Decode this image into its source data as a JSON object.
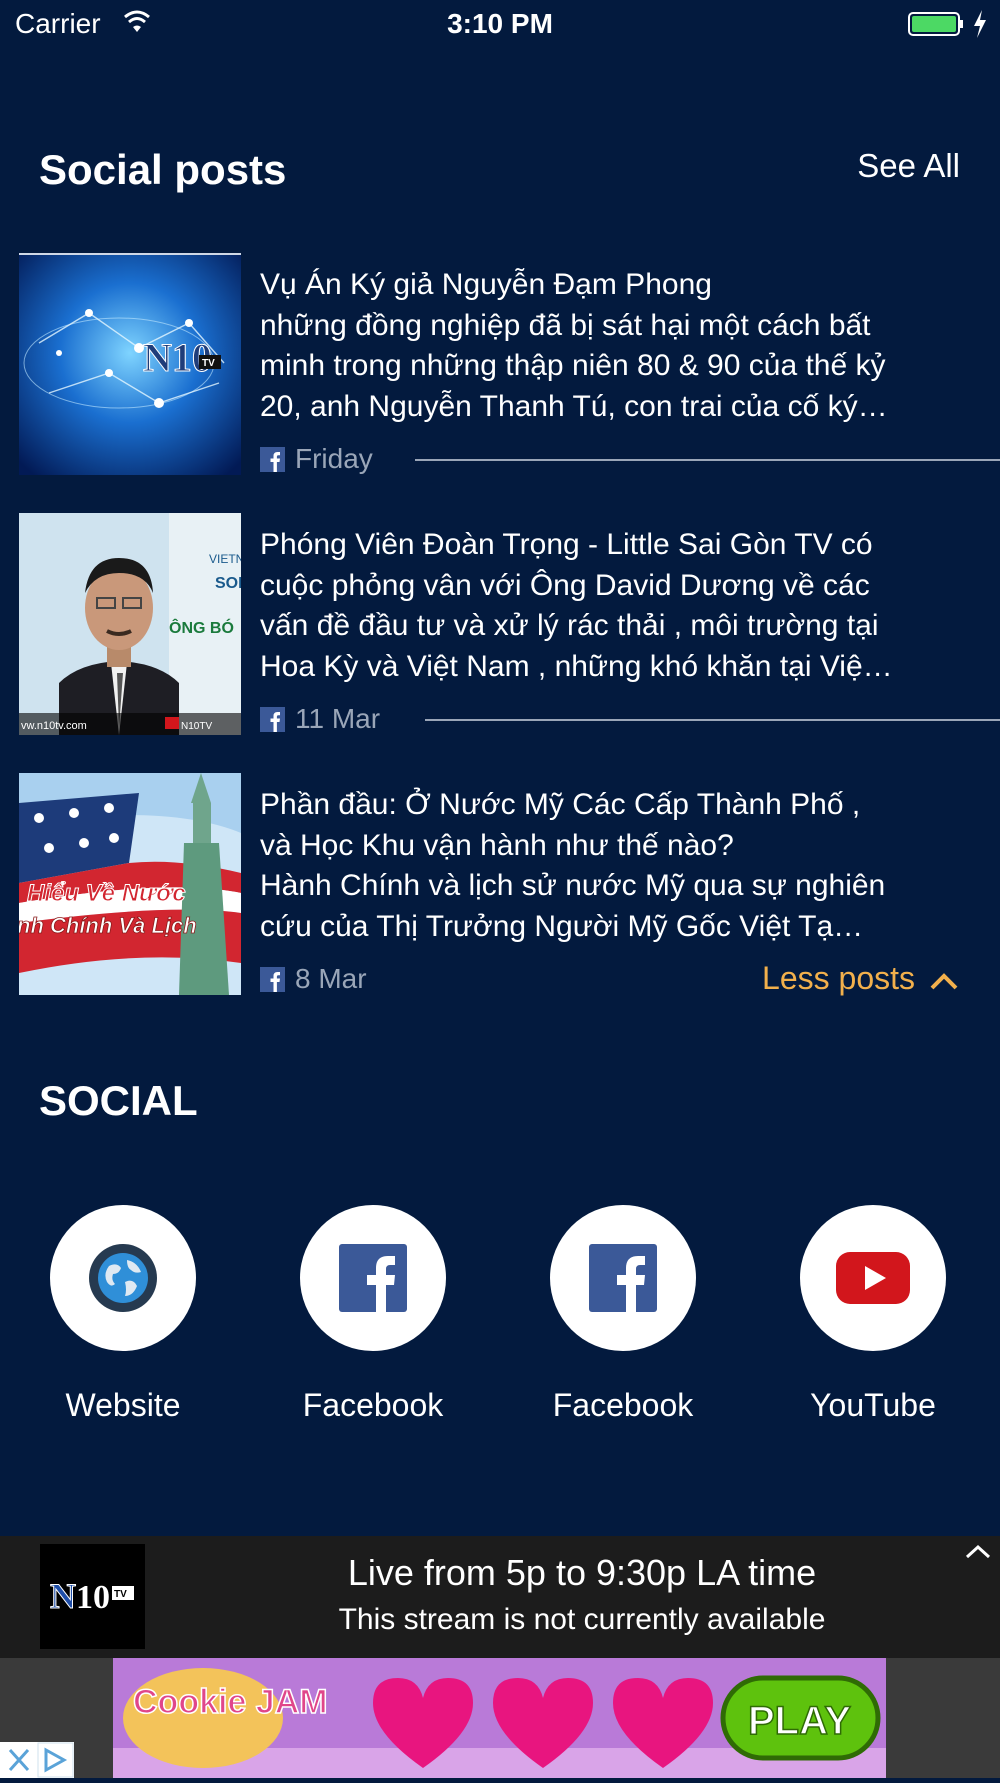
{
  "status_bar": {
    "carrier": "Carrier",
    "time": "3:10 PM"
  },
  "social_posts": {
    "title": "Social posts",
    "see_all": "See All",
    "posts": [
      {
        "lines": [
          "Vụ Án Ký giả Nguyễn Đạm Phong",
          "những đồng nghiệp đã bị sát hại một cách bất",
          "minh trong những thập niên 80 & 90 của thế kỷ",
          "20, anh Nguyễn Thanh Tú, con trai của cố ký…"
        ],
        "date": "Friday",
        "thumb_text": "N10"
      },
      {
        "lines": [
          "Phóng Viên Đoàn Trọng - Little Sai Gòn TV có",
          "cuộc phỏng vân với Ông David Dương về các",
          "vấn đề đầu tư và xử lý rác thải , môi trường tại",
          "Hoa Kỳ và Việt Nam , những khó khăn tại Việ…"
        ],
        "date": "11 Mar",
        "thumb_text": "vw.n10tv.com"
      },
      {
        "lines": [
          "Phần đầu: Ở Nước Mỹ Các Cấp Thành Phố ,",
          "và Học Khu vận hành như thế nào?",
          "Hành Chính và lịch sử nước Mỹ qua sự nghiên",
          "cứu của Thị Trưởng Người Mỹ Gốc Việt  Tạ…"
        ],
        "date": "8 Mar",
        "thumb_text_1": "Hiểu Về Nước",
        "thumb_text_2": "nh Chính Và Lịch"
      }
    ],
    "less_posts": "Less posts"
  },
  "social": {
    "title": "SOCIAL",
    "items": [
      {
        "label": "Website",
        "icon": "globe-icon"
      },
      {
        "label": "Facebook",
        "icon": "facebook-icon"
      },
      {
        "label": "Facebook",
        "icon": "facebook-icon"
      },
      {
        "label": "YouTube",
        "icon": "youtube-icon"
      }
    ]
  },
  "player": {
    "title": "Live from 5p to 9:30p LA time",
    "subtitle": "This stream is not currently available"
  },
  "ad": {
    "text_left": "Cookie JAM",
    "text_right": "PLAY"
  },
  "colors": {
    "background": "#031a3e",
    "accent": "#f2b04c",
    "facebook": "#3b5998",
    "youtube": "#d2161c"
  }
}
